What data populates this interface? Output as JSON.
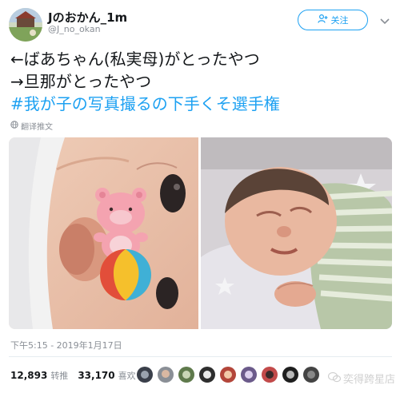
{
  "user": {
    "display_name": "Jのおかん_1m",
    "handle": "@J_no_okan"
  },
  "follow_button": {
    "label": "关注"
  },
  "tweet": {
    "lines": [
      "←ばあちゃん(私実母)がとったやつ",
      "→旦那がとったやつ",
      "#我が子の写真撮るの下手くそ選手権"
    ],
    "translate_label": "翻译推文"
  },
  "timestamp": "下午5:15 - 2019年1月17日",
  "stats": {
    "retweets_value": "12,893",
    "retweets_label": "转推",
    "likes_value": "33,170",
    "likes_label": "喜欢"
  },
  "watermark": {
    "text": "奕得跨星店"
  },
  "icons": {
    "follow": "add-user-icon",
    "more": "chevron-down-icon",
    "translate": "globe-icon",
    "watermark": "wechat-icon"
  },
  "colors": {
    "accent": "#1da1f2",
    "text": "#14171a",
    "muted": "#8a8f96"
  }
}
